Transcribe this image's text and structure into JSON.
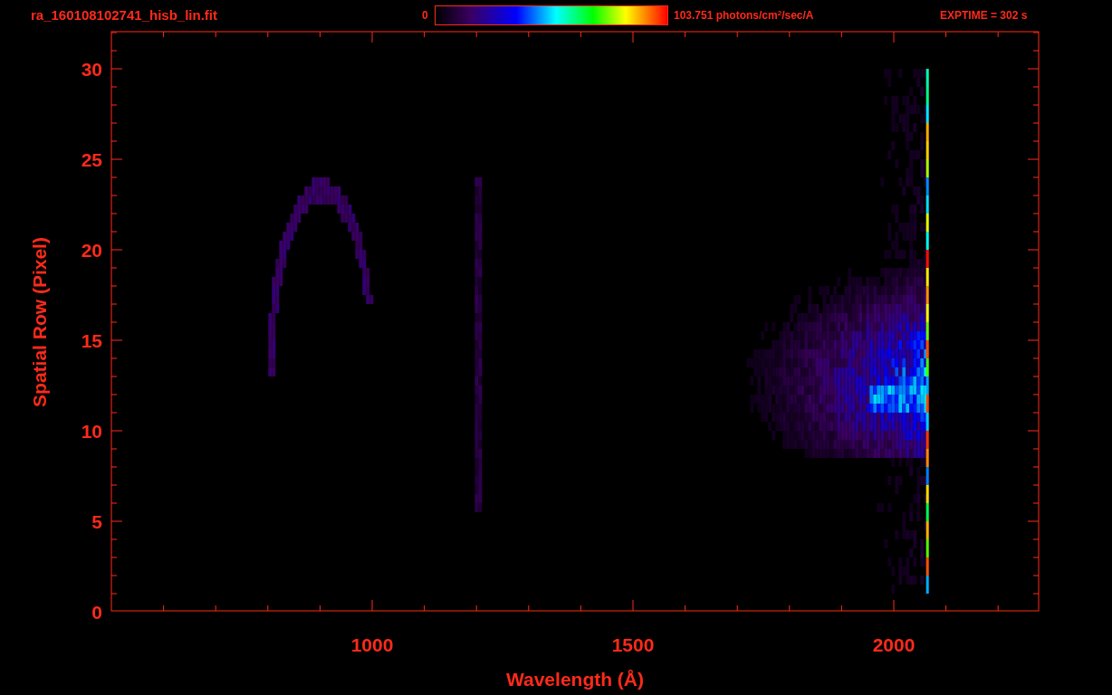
{
  "header": {
    "filename": "ra_160108102741_hisb_lin.fit",
    "colorbar": {
      "min_label": "0",
      "max_label": "103.751 photons/cm$^{2}$/sec/A"
    },
    "exposure": "EXPTIME = 302 s"
  },
  "plot": {
    "y_axis": {
      "label": "Spatial Row (Pixel)",
      "ticks": [
        "30",
        "25",
        "20",
        "15",
        "10",
        "5",
        "0"
      ]
    },
    "x_axis": {
      "label": "Wavelength (Å)",
      "ticks": [
        "1000",
        "1500",
        "2000"
      ]
    }
  }
}
